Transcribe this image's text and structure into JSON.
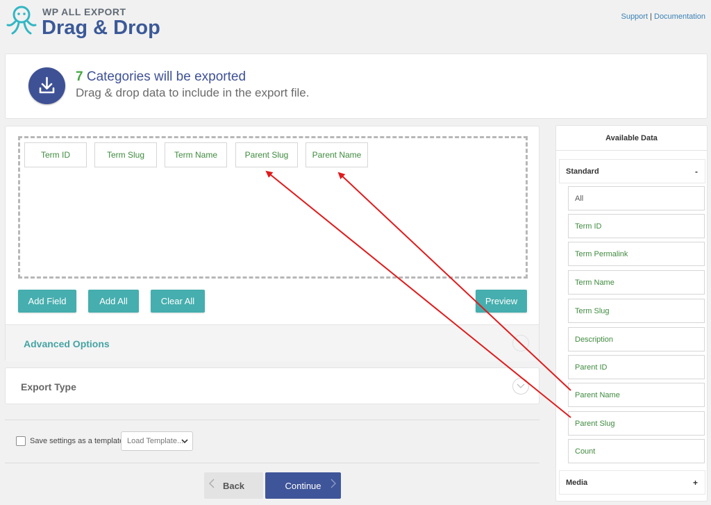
{
  "header": {
    "brand_top": "WP ALL EXPORT",
    "brand_main": "Drag & Drop",
    "support_link": "Support",
    "separator": "|",
    "docs_link": "Documentation"
  },
  "summary": {
    "count": "7",
    "title_rest": " Categories will be exported",
    "subtitle": "Drag & drop data to include in the export file."
  },
  "export_fields": [
    "Term ID",
    "Term Slug",
    "Term Name",
    "Parent Slug",
    "Parent Name"
  ],
  "actions": {
    "add_field": "Add Field",
    "add_all": "Add All",
    "clear_all": "Clear All",
    "preview": "Preview"
  },
  "advanced_options": "Advanced Options",
  "export_type": "Export Type",
  "template": {
    "save_label": "Save settings as a template",
    "load_placeholder": "Load Template..."
  },
  "nav": {
    "back": "Back",
    "continue": "Continue"
  },
  "available_data": {
    "title": "Available Data",
    "standard": {
      "label": "Standard",
      "toggle": "-"
    },
    "items": [
      "All",
      "Term ID",
      "Term Permalink",
      "Term Name",
      "Term Slug",
      "Description",
      "Parent ID",
      "Parent Name",
      "Parent Slug",
      "Count"
    ],
    "media": {
      "label": "Media",
      "toggle": "+"
    }
  },
  "colors": {
    "brand_blue": "#3e5195",
    "teal": "#46aeae",
    "field_green": "#3e8a3e",
    "annotation_red": "#e01b1b"
  }
}
